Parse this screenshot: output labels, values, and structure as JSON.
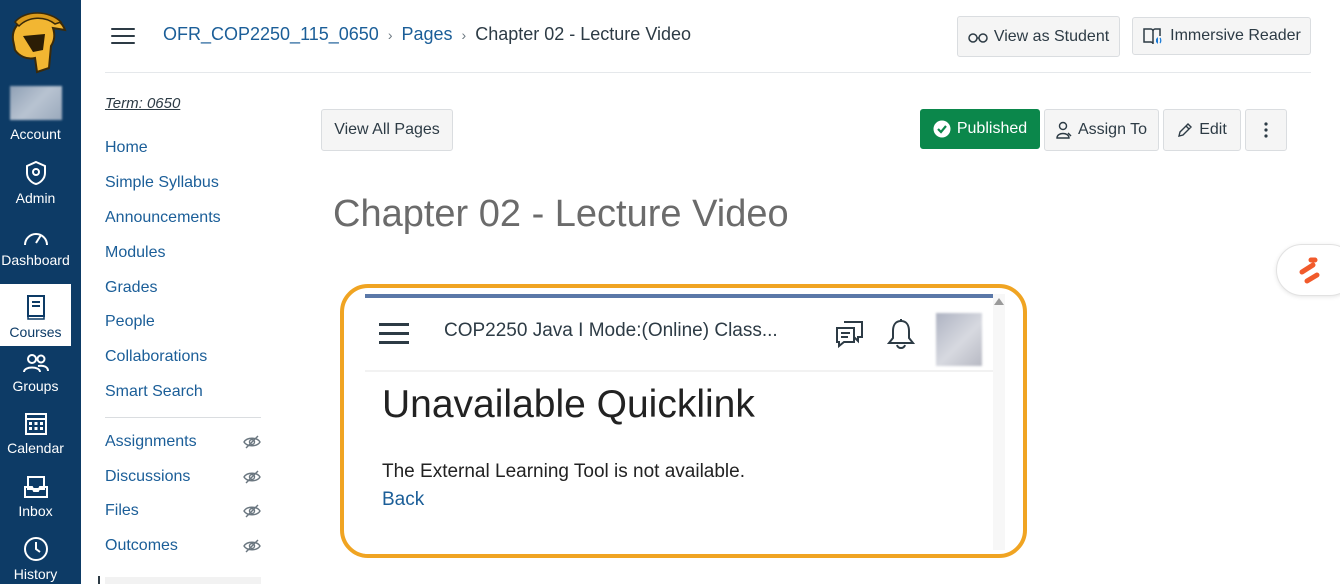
{
  "global_nav": {
    "items": [
      {
        "label": "Account",
        "icon": "account-avatar"
      },
      {
        "label": "Admin",
        "icon": "shield-icon"
      },
      {
        "label": "Dashboard",
        "icon": "dashboard-icon"
      },
      {
        "label": "Courses",
        "icon": "book-icon"
      },
      {
        "label": "Groups",
        "icon": "groups-icon"
      },
      {
        "label": "Calendar",
        "icon": "calendar-icon"
      },
      {
        "label": "Inbox",
        "icon": "inbox-icon"
      },
      {
        "label": "History",
        "icon": "clock-icon"
      }
    ],
    "colors": {
      "bg": "#0d3b66",
      "active_bg": "#ffffff"
    }
  },
  "header": {
    "breadcrumbs": [
      "OFR_COP2250_115_0650",
      "Pages",
      "Chapter 02 - Lecture Video"
    ],
    "view_as_student": "View as Student",
    "immersive_reader": "Immersive Reader"
  },
  "course_nav": {
    "term": "Term: 0650",
    "items": [
      "Home",
      "Simple Syllabus",
      "Announcements",
      "Modules",
      "Grades",
      "People",
      "Collaborations",
      "Smart Search"
    ],
    "hidden_items": [
      "Assignments",
      "Discussions",
      "Files",
      "Outcomes"
    ]
  },
  "toolbar": {
    "view_all_pages": "View All Pages",
    "published": "Published",
    "assign_to": "Assign To",
    "edit": "Edit",
    "colors": {
      "published_bg": "#0b874b"
    }
  },
  "page": {
    "title": "Chapter 02 - Lecture Video"
  },
  "embed": {
    "course_title": "COP2250 Java I Mode:(Online) Class...",
    "heading": "Unavailable Quicklink",
    "message": "The External Learning Tool is not available.",
    "back_link": "Back",
    "colors": {
      "border": "#f0a422",
      "topbar": "#5b78a8"
    }
  }
}
